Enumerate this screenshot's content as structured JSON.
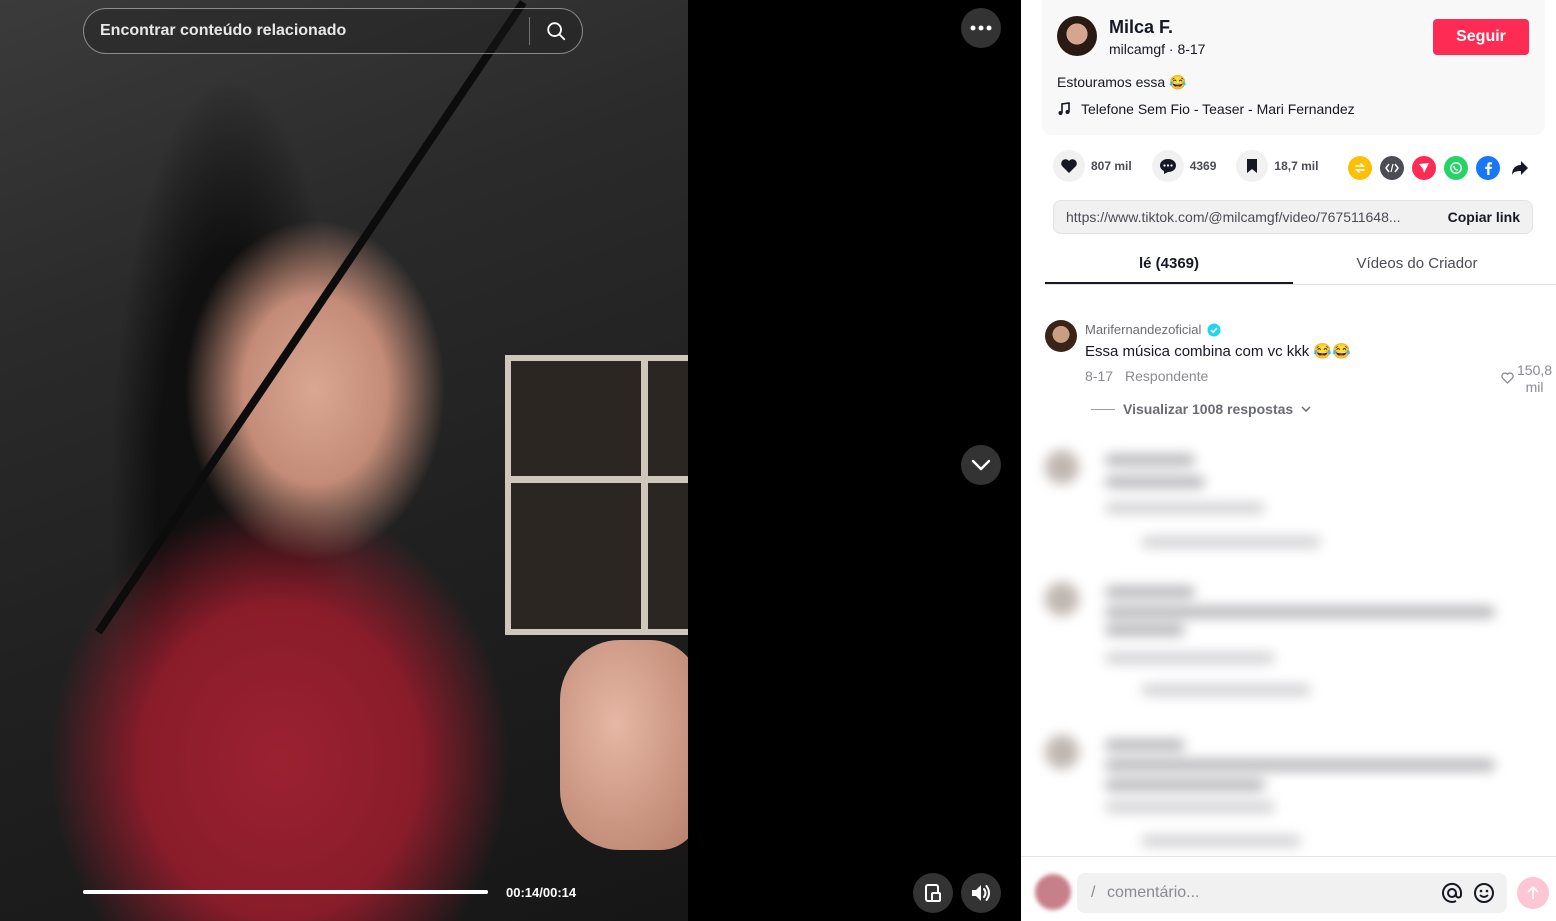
{
  "search": {
    "placeholder": "Encontrar conteúdo relacionado"
  },
  "player": {
    "time": "00:14/00:14",
    "progress_fraction": 1.0
  },
  "author": {
    "name": "Milca F.",
    "handle_date": "milcamgf · 8-17",
    "follow_label": "Seguir",
    "caption": "Estouramos essa 😂",
    "music": "Telefone Sem Fio - Teaser - Mari Fernandez"
  },
  "stats": {
    "likes": "807 mil",
    "comments": "4369",
    "saves": "18,7 mil"
  },
  "share_icons": [
    "repost-icon",
    "embed-icon",
    "send-icon",
    "whatsapp-icon",
    "facebook-icon",
    "share-arrow-icon"
  ],
  "link": {
    "url": "https://www.tiktok.com/@milcamgf/video/767511648...",
    "copy_label": "Copiar link"
  },
  "tabs": [
    {
      "label": "lé (4369)"
    },
    {
      "label": "Vídeos do Criador"
    }
  ],
  "comment": {
    "user": "Marifernandezoficial",
    "text": "Essa música combina com vc kkk 😂😂",
    "date": "8-17",
    "reply_label": "Respondente",
    "likes_line1": "150,8",
    "likes_line2": "mil",
    "view_replies": "Visualizar 1008 respostas"
  },
  "composer": {
    "placeholder": "comentário..."
  },
  "colors": {
    "accent": "#fe2c55",
    "verified": "#20d5ec"
  }
}
